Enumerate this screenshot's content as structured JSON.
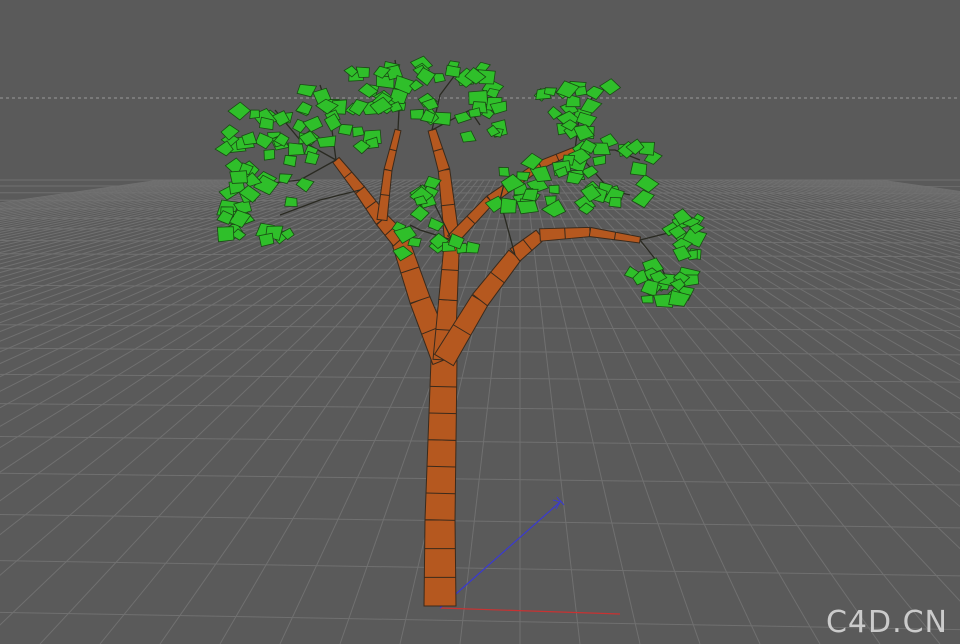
{
  "viewport": {
    "background_color": "#5a5a5a",
    "grid_line_color": "#707070",
    "horizon_line_style": "dashed"
  },
  "scene_object": {
    "type": "tree",
    "trunk_color": "#b5581f",
    "trunk_edge_color": "#3a2a1c",
    "leaf_color": "#2fbf2a",
    "leaf_edge_color": "#1a4a14"
  },
  "axes": {
    "x_axis_color": "#c83232",
    "z_axis_color": "#3a3ad0"
  },
  "watermark": {
    "text": "C4D.CN"
  }
}
